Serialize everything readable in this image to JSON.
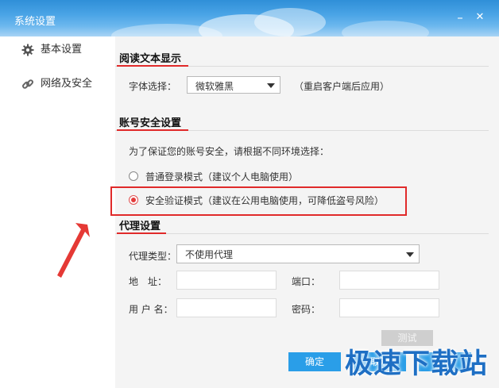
{
  "window": {
    "title": "系统设置",
    "minimize_glyph": "–",
    "close_glyph": "✕"
  },
  "sidebar": {
    "items": [
      {
        "label": "基本设置",
        "icon": "gear-icon"
      },
      {
        "label": "网络及安全",
        "icon": "link-icon"
      }
    ]
  },
  "reading": {
    "title": "阅读文本显示",
    "font_label": "字体选择：",
    "font_value": "微软雅黑",
    "restart_note": "（重启客户端后应用）"
  },
  "account": {
    "title": "账号安全设置",
    "intro": "为了保证您的账号安全，请根据不同环境选择：",
    "normal_mode": "普通登录模式（建议个人电脑使用）",
    "secure_mode": "安全验证模式（建议在公用电脑使用，可降低盗号风险）",
    "selected": "secure"
  },
  "proxy": {
    "title": "代理设置",
    "type_label": "代理类型：",
    "type_value": "不使用代理",
    "address_label": "地　址：",
    "port_label": "端口：",
    "username_label": "用 户 名：",
    "password_label": "密码：",
    "test_button": "测试"
  },
  "footer": {
    "ok_button": "确定",
    "cancel_button": "取消",
    "apply_button": "应用"
  },
  "watermark": "极速下载站",
  "colors": {
    "accent_blue": "#2a9ee8",
    "highlight_red": "#e02a2a",
    "arrow_red": "#e53935"
  }
}
